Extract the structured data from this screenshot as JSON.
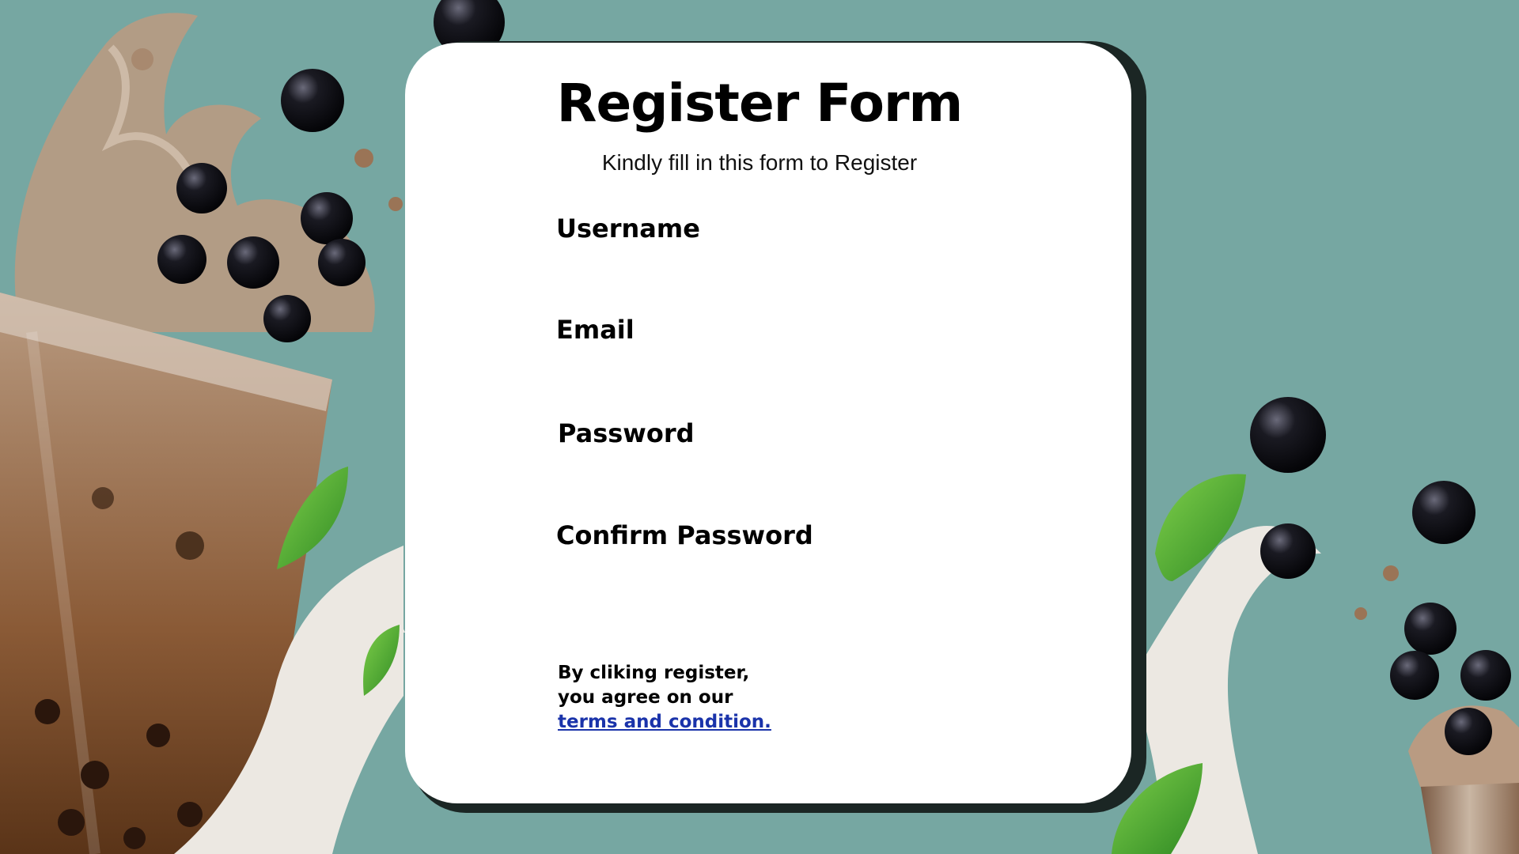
{
  "form": {
    "title": "Register Form",
    "subtitle": "Kindly fill in this form to Register",
    "fields": [
      {
        "label": "Username",
        "value": ""
      },
      {
        "label": "Email",
        "value": ""
      },
      {
        "label": "Password",
        "value": ""
      },
      {
        "label": "Confirm Password",
        "value": ""
      }
    ],
    "terms": {
      "line1": "By cliking register,",
      "line2": "you agree on our",
      "link": "terms and condition."
    }
  },
  "colors": {
    "background": "#76a7a2",
    "card": "#ffffff",
    "card_shadow": "#1b2624",
    "link": "#1a33aa"
  },
  "decorations": {
    "left": "bubble-tea-cup-splash-illustration",
    "right": "bubble-tea-cup-splash-illustration"
  }
}
